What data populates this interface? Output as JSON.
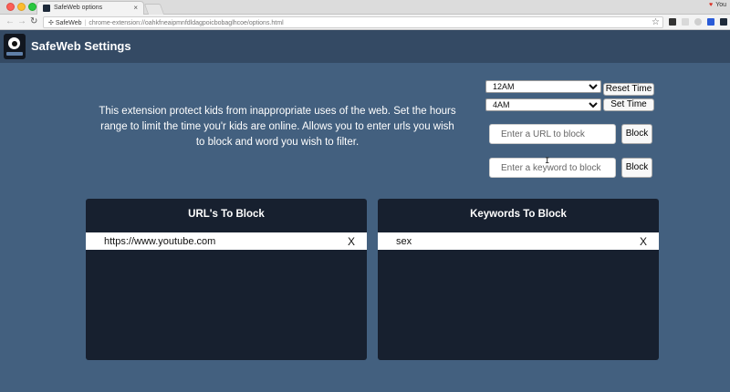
{
  "browser": {
    "tab_title": "SafeWeb options",
    "profile_name": "You",
    "omnibox": {
      "site_label": "SafeWeb",
      "url": "chrome-extension://oahkfneaipmnfdldagpoicbobaglhcoe/options.html"
    }
  },
  "header": {
    "title": "SafeWeb Settings"
  },
  "description": "This extension protect kids from inappropriate uses of the web. Set the hours range to limit the time you'r kids are online. Allows you to enter urls you wish to block and word you wish to filter.",
  "time_controls": {
    "start_time": "12AM",
    "end_time": "4AM",
    "reset_label": "Reset Time",
    "set_label": "Set Time"
  },
  "block_controls": {
    "url_placeholder": "Enter a URL to block",
    "keyword_placeholder": "Enter a keyword to block",
    "block_label": "Block"
  },
  "panels": {
    "urls": {
      "title": "URL's To Block",
      "items": [
        {
          "text": "https://www.youtube.com",
          "remove": "X"
        }
      ]
    },
    "keywords": {
      "title": "Keywords To Block",
      "items": [
        {
          "text": "sex",
          "remove": "X"
        }
      ]
    }
  },
  "colors": {
    "page_bg": "#43607f",
    "header_bg": "#344a64",
    "panel_bg": "#17202f"
  },
  "icons": [
    "close-icon",
    "extension-icon",
    "star-icon",
    "app-logo-icon",
    "back-icon",
    "forward-icon",
    "reload-icon"
  ]
}
